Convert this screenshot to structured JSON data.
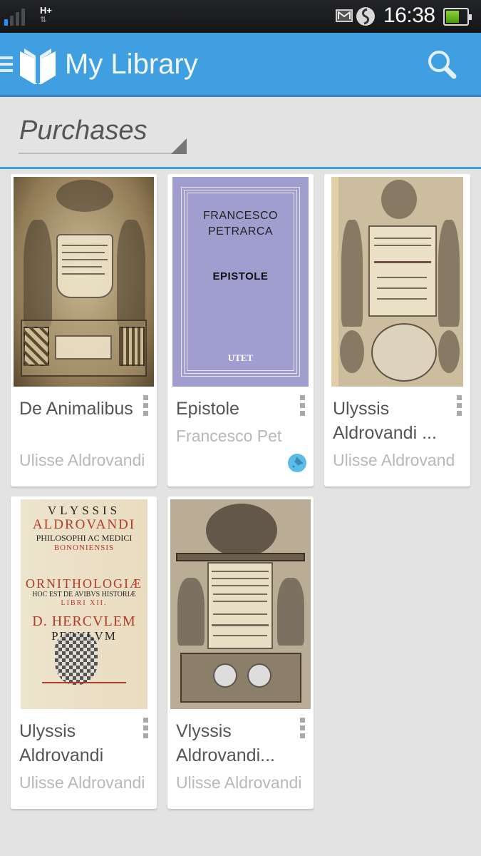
{
  "status_bar": {
    "network_type": "H+",
    "time": "16:38",
    "icons": [
      "signal-icon",
      "gmail-icon",
      "sync-icon",
      "battery-icon"
    ],
    "signal_level": 0.25,
    "battery_level": 0.55
  },
  "app_bar": {
    "title": "My Library",
    "background": "#3f9fe0"
  },
  "filter": {
    "selected": "Purchases"
  },
  "books": [
    {
      "title": "De Animalibus",
      "author": "Ulisse Aldrovandi",
      "cover_style": "engraving"
    },
    {
      "title": "Epistole",
      "author": "Francesco Pet",
      "pinned": true,
      "cover": {
        "author_line1": "FRANCESCO",
        "author_line2": "PETRARCA",
        "title": "EPISTOLE",
        "publisher": "UTET",
        "color": "#a09dcf"
      }
    },
    {
      "title": "Ulyssis Aldrovandi ...",
      "author": "Ulisse Aldrovand",
      "cover_style": "engraving"
    },
    {
      "title": "Ulyssis Aldrovandi",
      "author": "Ulisse Aldrovandi",
      "cover": {
        "line1": "VLYSSIS",
        "line2": "ALDROVANDI",
        "line3": "PHILOSOPHI AC MEDICI",
        "line4": "BONONIENSIS",
        "line5": "ORNITHOLOGIÆ",
        "line6": "HOC EST DE AVIBVS HISTORIÆ",
        "line7": "LIBRI XII.",
        "line8": "D. HERCVLEM",
        "line9": "PEPVLVM"
      }
    },
    {
      "title": "Vlyssis Aldrovandi...",
      "author": "Ulisse Aldrovandi",
      "cover_style": "engraving"
    }
  ]
}
